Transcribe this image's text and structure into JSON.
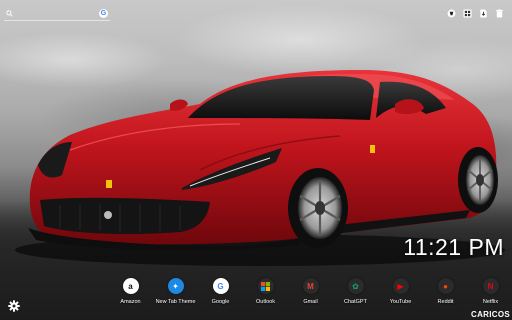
{
  "search": {
    "placeholder": "",
    "engine_icon": "google-icon",
    "engine_glyph": "G"
  },
  "toolbar": {
    "icons": [
      "ferrari-shield-icon",
      "gallery-icon",
      "download-icon",
      "trash-icon"
    ]
  },
  "clock": {
    "time": "11:21 PM"
  },
  "shortcuts": [
    {
      "label": "Amazon",
      "icon": "amazon-icon",
      "glyph": "a",
      "color": "#ffffff"
    },
    {
      "label": "New Tab Theme",
      "icon": "new-tab-theme-icon",
      "glyph": "✦",
      "color": "#1e88e5"
    },
    {
      "label": "Google",
      "icon": "google-icon",
      "glyph": "G",
      "color": "#4285f4"
    },
    {
      "label": "Outlook",
      "icon": "outlook-icon",
      "glyph": "",
      "color": "#f25022"
    },
    {
      "label": "Gmail",
      "icon": "gmail-icon",
      "glyph": "M",
      "color": "#ea4335"
    },
    {
      "label": "ChatGPT",
      "icon": "chatgpt-icon",
      "glyph": "✿",
      "color": "#10a37f"
    },
    {
      "label": "YouTube",
      "icon": "youtube-icon",
      "glyph": "▶",
      "color": "#ff0000"
    },
    {
      "label": "Reddit",
      "icon": "reddit-icon",
      "glyph": "●",
      "color": "#ff4500"
    },
    {
      "label": "Netflix",
      "icon": "netflix-icon",
      "glyph": "N",
      "color": "#e50914"
    }
  ],
  "settings": {
    "icon": "gear-icon"
  },
  "brand": {
    "text": "CARICOS"
  },
  "colors": {
    "car_red": "#c0141c",
    "sky": "#bdbdbd",
    "road": "#1c1c1c"
  }
}
